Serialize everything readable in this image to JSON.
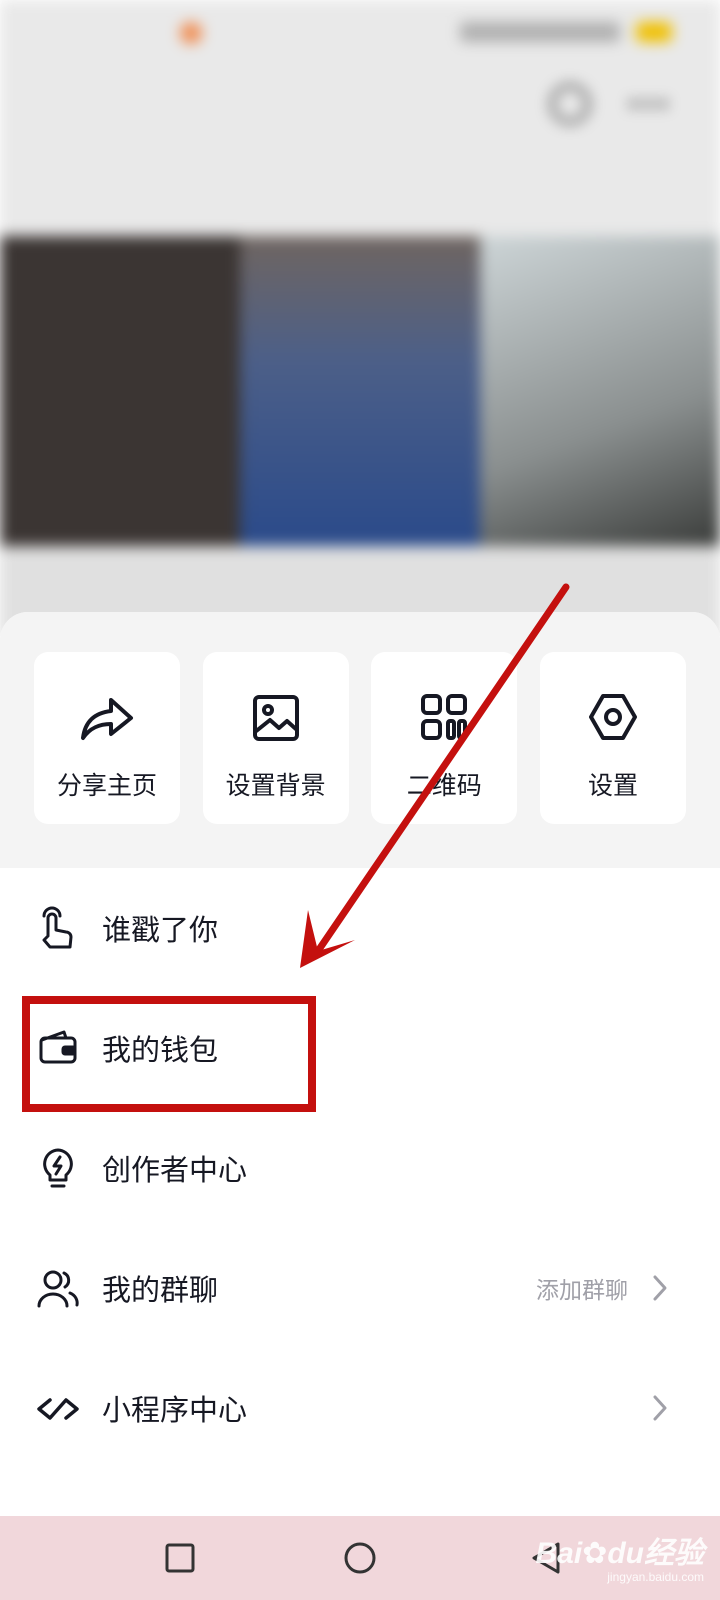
{
  "quick_actions": [
    {
      "label": "分享主页",
      "icon": "share-icon"
    },
    {
      "label": "设置背景",
      "icon": "image-icon"
    },
    {
      "label": "二维码",
      "icon": "qr-code-icon"
    },
    {
      "label": "设置",
      "icon": "settings-icon"
    }
  ],
  "menu": [
    {
      "label": "谁戳了你",
      "extra": "",
      "icon": "tap-hand-icon"
    },
    {
      "label": "我的钱包",
      "extra": "",
      "icon": "wallet-icon"
    },
    {
      "label": "创作者中心",
      "extra": "",
      "icon": "lightbulb-icon"
    },
    {
      "label": "我的群聊",
      "extra": "添加群聊",
      "icon": "group-users-icon"
    },
    {
      "label": "小程序中心",
      "extra": "",
      "icon": "mini-program-icon"
    }
  ],
  "annotation": {
    "color": "#c4100e",
    "highlighted_item": "我的钱包"
  },
  "watermark": {
    "brand": "Bai",
    "brand2": "du",
    "suffix": "经验",
    "url": "jingyan.baidu.com"
  }
}
